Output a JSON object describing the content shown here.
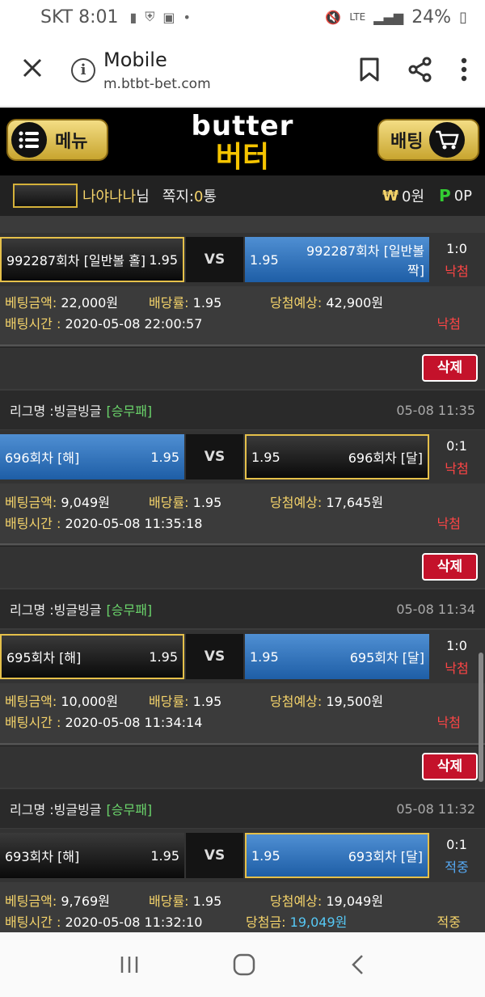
{
  "status": {
    "carrier_time": "SKT 8:01",
    "signal": "LTE",
    "battery": "24%"
  },
  "browser": {
    "title": "Mobile",
    "url": "m.btbt-bet.com"
  },
  "header": {
    "menu_label": "메뉴",
    "bet_label": "배팅",
    "logo_en": "butter",
    "logo_ko": "버터"
  },
  "user": {
    "name": "나야나나",
    "suffix": "님",
    "msg_label": "쪽지:",
    "msg_count": "0",
    "msg_unit": "통",
    "won_symbol": "₩",
    "money": "0원",
    "point_symbol": "P",
    "points": "0P"
  },
  "bets": [
    {
      "match": {
        "left_name": "992287회차 [일반볼 홀]",
        "left_odds": "1.95",
        "right_name": "992287회차 [일반볼 짝]",
        "right_odds": "1.95",
        "vs": "VS",
        "score": "1:0",
        "result": "낙첨"
      },
      "info": {
        "amount_label": "베팅금액:",
        "amount": "22,000원",
        "odds_label": "배당률:",
        "odds": "1.95",
        "expect_label": "당첨예상:",
        "expect": "42,900원",
        "time_label": "배팅시간 :",
        "time": "2020-05-08 22:00:57",
        "status": "낙첨"
      },
      "delete_label": "삭제"
    },
    {
      "league": {
        "label": "리그명 : ",
        "name": "빙글빙글",
        "category": "[승무패]",
        "datetime": "05-08 11:35"
      },
      "match": {
        "left_name": "696회차 [해]",
        "left_odds": "1.95",
        "right_name": "696회차 [달]",
        "right_odds": "1.95",
        "vs": "VS",
        "score": "0:1",
        "result": "낙첨"
      },
      "info": {
        "amount_label": "베팅금액:",
        "amount": "9,049원",
        "odds_label": "배당률:",
        "odds": "1.95",
        "expect_label": "당첨예상:",
        "expect": "17,645원",
        "time_label": "배팅시간 :",
        "time": "2020-05-08 11:35:18",
        "status": "낙첨"
      },
      "delete_label": "삭제"
    },
    {
      "league": {
        "label": "리그명 : ",
        "name": "빙글빙글",
        "category": "[승무패]",
        "datetime": "05-08 11:34"
      },
      "match": {
        "left_name": "695회차 [해]",
        "left_odds": "1.95",
        "right_name": "695회차 [달]",
        "right_odds": "1.95",
        "vs": "VS",
        "score": "1:0",
        "result": "낙첨"
      },
      "info": {
        "amount_label": "베팅금액:",
        "amount": "10,000원",
        "odds_label": "배당률:",
        "odds": "1.95",
        "expect_label": "당첨예상:",
        "expect": "19,500원",
        "time_label": "배팅시간 :",
        "time": "2020-05-08 11:34:14",
        "status": "낙첨"
      },
      "delete_label": "삭제"
    },
    {
      "league": {
        "label": "리그명 : ",
        "name": "빙글빙글",
        "category": "[승무패]",
        "datetime": "05-08 11:32"
      },
      "match": {
        "left_name": "693회차 [해]",
        "left_odds": "1.95",
        "right_name": "693회차 [달]",
        "right_odds": "1.95",
        "vs": "VS",
        "score": "0:1",
        "result": "적중"
      },
      "info": {
        "amount_label": "베팅금액:",
        "amount": "9,769원",
        "odds_label": "배당률:",
        "odds": "1.95",
        "expect_label": "당첨예상:",
        "expect": "19,049원",
        "time_label": "배팅시간 :",
        "time": "2020-05-08 11:32:10",
        "prize_label": "당첨금:",
        "prize": "19,049원",
        "status": "적중"
      }
    }
  ]
}
